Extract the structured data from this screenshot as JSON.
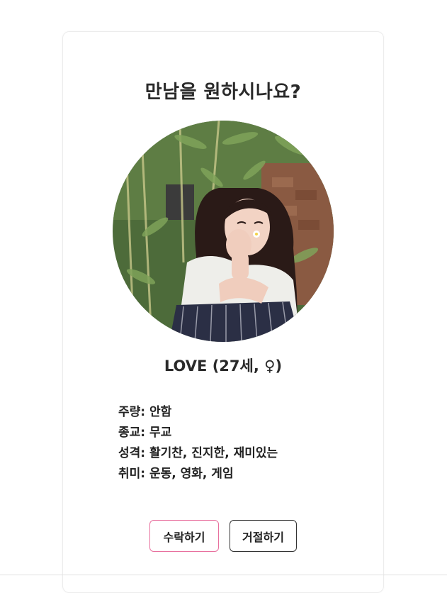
{
  "modal": {
    "title": "만남을 원하시나요?",
    "profile_name": "LOVE (27세, ♀)",
    "details": [
      {
        "label": "주량",
        "value": "안함",
        "text": "주량: 안함"
      },
      {
        "label": "종교",
        "value": "무교",
        "text": "종교: 무교"
      },
      {
        "label": "성격",
        "value": "활기찬, 진지한, 재미있는",
        "text": "성격: 활기찬, 진지한, 재미있는"
      },
      {
        "label": "취미",
        "value": "운동, 영화, 게임",
        "text": "취미: 운동, 영화, 게임"
      }
    ],
    "accept_label": "수락하기",
    "reject_label": "거절하기"
  },
  "colors": {
    "accept_border": "#e8709e",
    "reject_border": "#333333"
  }
}
